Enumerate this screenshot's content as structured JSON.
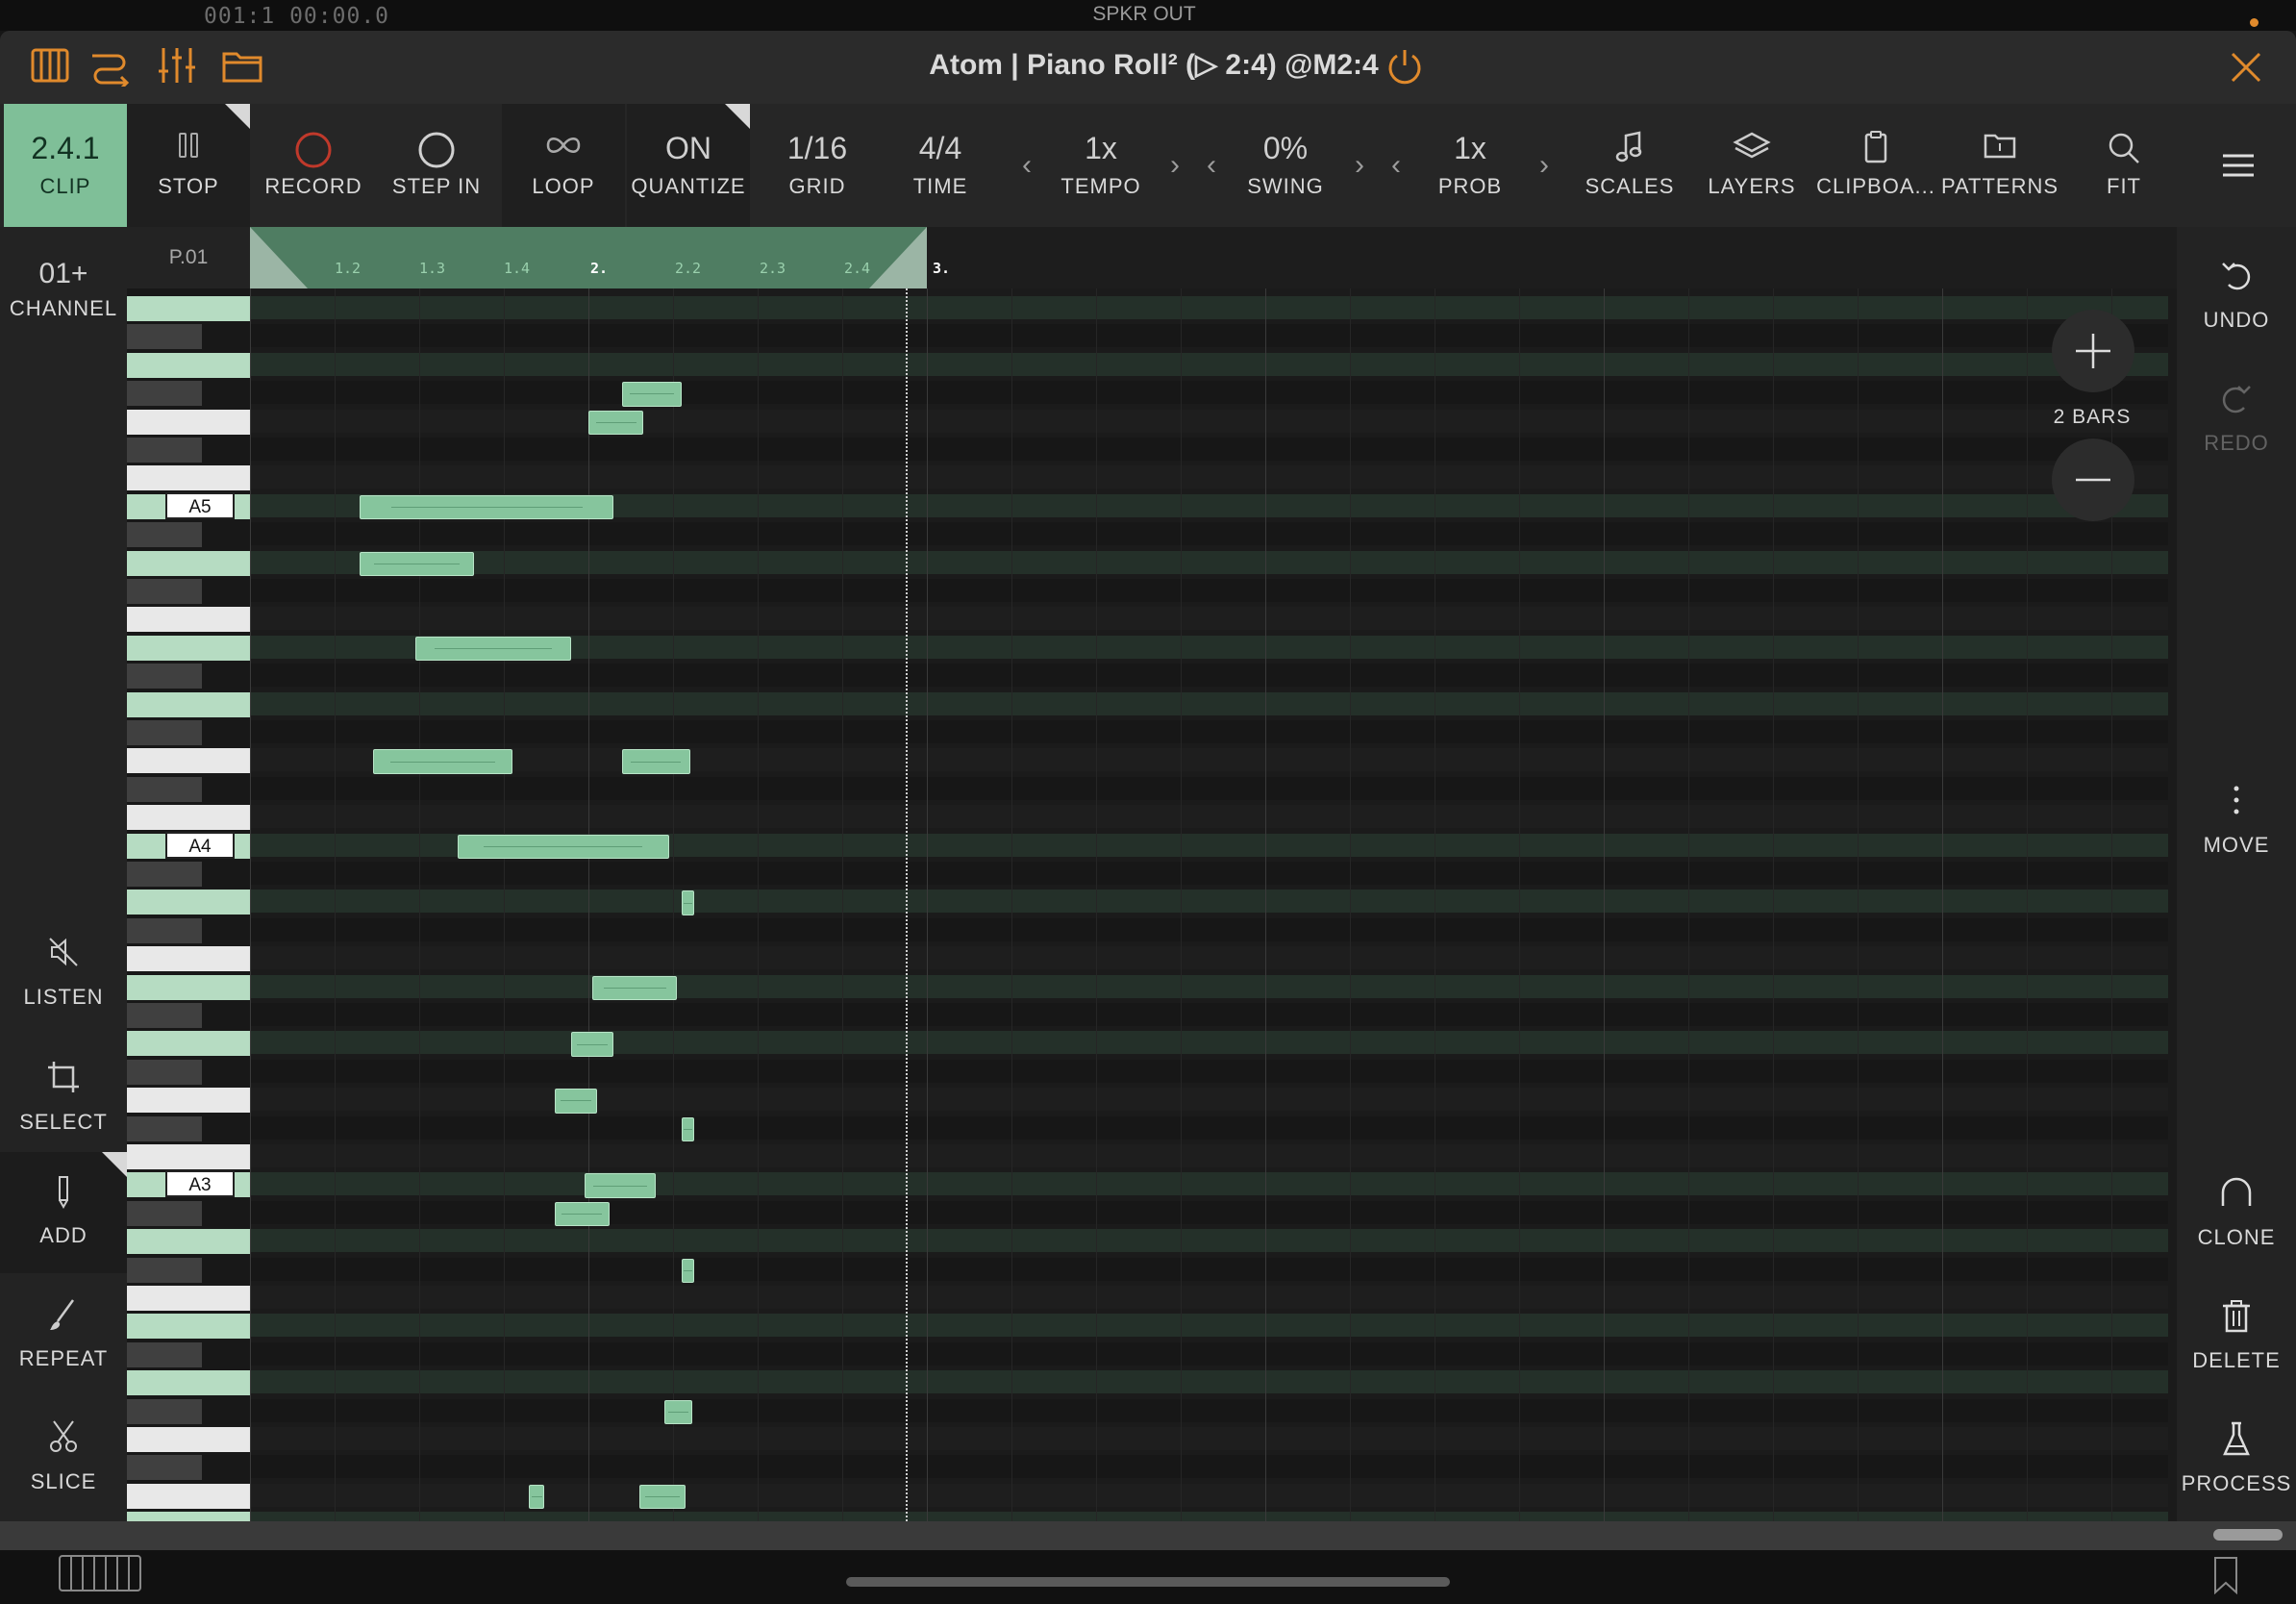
{
  "status_bar": {
    "counter": "001:1  00:00.0",
    "output": "SPKR OUT"
  },
  "title_bar": {
    "title": "Atom | Piano Roll² (▷ 2:4) @M2:4",
    "icons": [
      "keyboard-icon",
      "routing-icon",
      "mixer-icon",
      "folder-icon",
      "power-icon",
      "close-icon"
    ],
    "accent_color": "#e08a2c"
  },
  "toolbar": {
    "clip": {
      "value": "2.4.1",
      "label": "CLIP"
    },
    "stop": {
      "label": "STOP"
    },
    "record": {
      "label": "RECORD"
    },
    "step_in": {
      "label": "STEP IN"
    },
    "loop": {
      "label": "LOOP"
    },
    "quantize": {
      "value": "ON",
      "label": "QUANTIZE"
    },
    "grid": {
      "value": "1/16",
      "label": "GRID"
    },
    "time": {
      "value": "4/4",
      "label": "TIME"
    },
    "tempo": {
      "value": "1x",
      "label": "TEMPO"
    },
    "swing": {
      "value": "0%",
      "label": "SWING"
    },
    "prob": {
      "value": "1x",
      "label": "PROB"
    },
    "scales": {
      "label": "SCALES"
    },
    "layers": {
      "label": "LAYERS"
    },
    "clipboard": {
      "label": "CLIPBOA..."
    },
    "patterns": {
      "label": "PATTERNS"
    },
    "fit": {
      "label": "FIT"
    },
    "prev_glyph": "‹",
    "next_glyph": "›"
  },
  "left_panel": {
    "channel": {
      "value": "01+",
      "label": "CHANNEL"
    },
    "pattern": "P.01",
    "tools": {
      "listen": "LISTEN",
      "select": "SELECT",
      "add": "ADD",
      "repeat": "REPEAT",
      "slice": "SLICE"
    }
  },
  "right_panel": {
    "undo": "UNDO",
    "redo": "REDO",
    "move": "MOVE",
    "clone": "CLONE",
    "delete": "DELETE",
    "process": "PROCESS",
    "zoom_label": "2 BARS"
  },
  "ruler": {
    "ticks": [
      "1.2",
      "1.3",
      "1.4",
      "2.",
      "2.2",
      "2.3",
      "2.4",
      "3."
    ]
  },
  "keyboard": {
    "labels": [
      "A5",
      "A4",
      "A3"
    ]
  },
  "colors": {
    "clip_bg": "#7fbf98",
    "note_fill": "#86c59d",
    "scale_key": "#b6dcc2",
    "record_ring": "#c0392b"
  }
}
